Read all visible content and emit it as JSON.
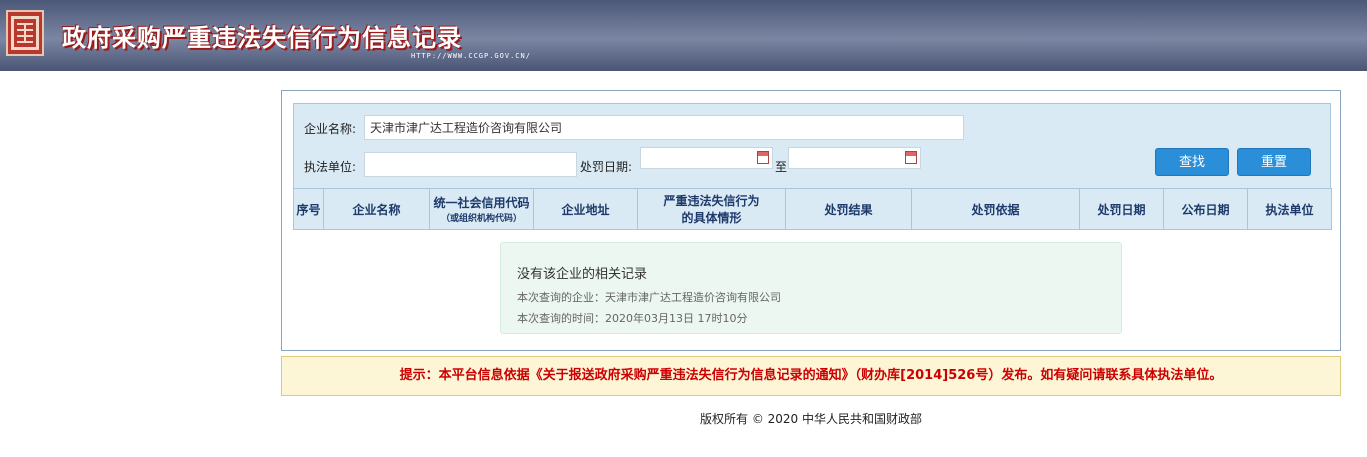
{
  "header": {
    "title": "政府采购严重违法失信行为信息记录",
    "url": "HTTP://WWW.CCGP.GOV.CN/"
  },
  "search": {
    "company_label": "企业名称:",
    "company_value": "天津市津广达工程造价咨询有限公司",
    "unit_label": "执法单位:",
    "unit_value": "",
    "date_label": "处罚日期:",
    "date_to": "至",
    "date_from_value": "",
    "date_to_value": "",
    "search_button": "查找",
    "reset_button": "重置"
  },
  "table": {
    "columns": [
      "序号",
      "企业名称",
      "统一社会信用代码",
      "企业地址",
      "严重违法失信行为的具体情形",
      "处罚结果",
      "处罚依据",
      "处罚日期",
      "公布日期",
      "执法单位"
    ],
    "credit_code_sub": "（或组织机构代码）",
    "situation_line1": "严重违法失信行为",
    "situation_line2": "的具体情形"
  },
  "result": {
    "message": "没有该企业的相关记录",
    "query_company": "本次查询的企业：天津市津广达工程造价咨询有限公司",
    "query_time": "本次查询的时间：2020年03月13日 17时10分"
  },
  "tip": "提示：本平台信息依据《关于报送政府采购严重违法失信行为信息记录的通知》（财办库[2014]526号）发布。如有疑问请联系具体执法单位。",
  "footer": "版权所有 © 2020 中华人民共和国财政部",
  "colors": {
    "header": "#5b6685",
    "title_shadow": "#9b1a1a",
    "button": "#2a8fd8",
    "table_header": "#d9eaf5",
    "tip_text": "#cc0000",
    "tip_bg": "#fcf6d6"
  },
  "icons": {
    "logo": "seal-logo",
    "calendar": "calendar-icon"
  }
}
